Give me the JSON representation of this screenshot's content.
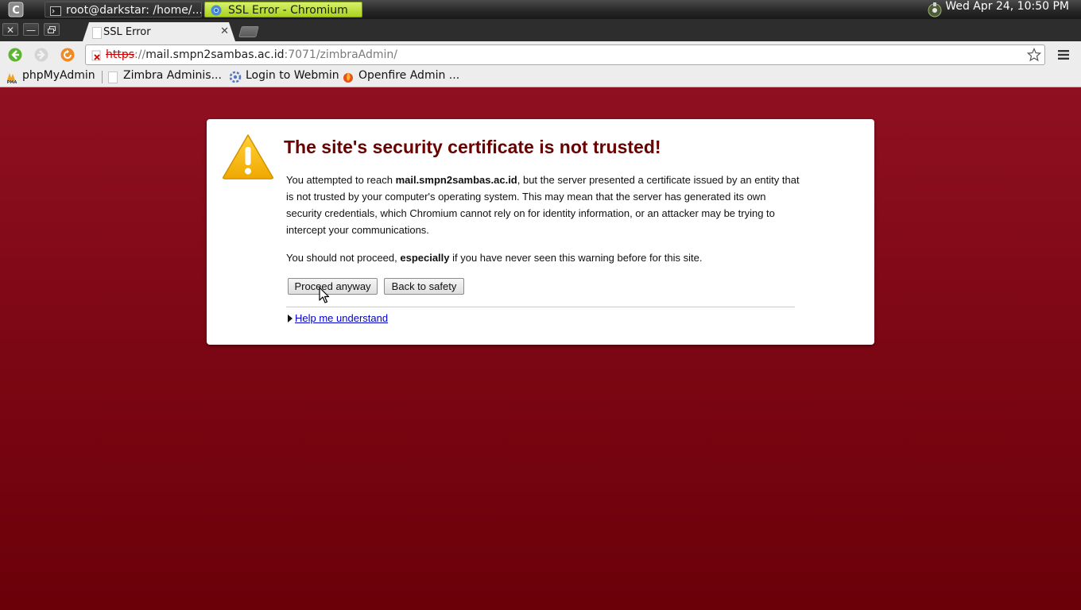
{
  "taskbar": {
    "tasks": [
      {
        "label": "root@darkstar: /home/..."
      },
      {
        "label": "SSL Error - Chromium"
      }
    ],
    "clock": "Wed Apr 24, 10:50 PM"
  },
  "window_controls": {
    "close": "✕",
    "minimize": "—",
    "maximize": "🗗"
  },
  "tab": {
    "title": "SSL Error",
    "close": "✕"
  },
  "omnibox": {
    "scheme": "https",
    "separator": "://",
    "host": "mail.smpn2sambas.ac.id",
    "path": ":7071/zimbraAdmin/"
  },
  "bookmarks": [
    {
      "label": "phpMyAdmin",
      "icon": "phpmyadmin-icon"
    },
    {
      "label": "Zimbra Adminis...",
      "icon": "page-icon"
    },
    {
      "label": "Login to Webmin",
      "icon": "webmin-icon"
    },
    {
      "label": "Openfire Admin ...",
      "icon": "openfire-icon"
    }
  ],
  "interstitial": {
    "headline": "The site's security certificate is not trusted!",
    "para1_pre": "You attempted to reach ",
    "para1_host": "mail.smpn2sambas.ac.id",
    "para1_post": ", but the server presented a certificate issued by an entity that is not trusted by your computer's operating system. This may mean that the server has generated its own security credentials, which Chromium cannot rely on for identity information, or an attacker may be trying to intercept your communications.",
    "para2_pre": "You should not proceed, ",
    "para2_bold": "especially",
    "para2_post": " if you have never seen this warning before for this site.",
    "proceed_label": "Proceed anyway",
    "back_label": "Back to safety",
    "help_label": "Help me understand"
  },
  "colors": {
    "page_background": "#7c0714",
    "headline": "#690000",
    "link": "#0000cc",
    "active_task": "#a8d21e"
  }
}
